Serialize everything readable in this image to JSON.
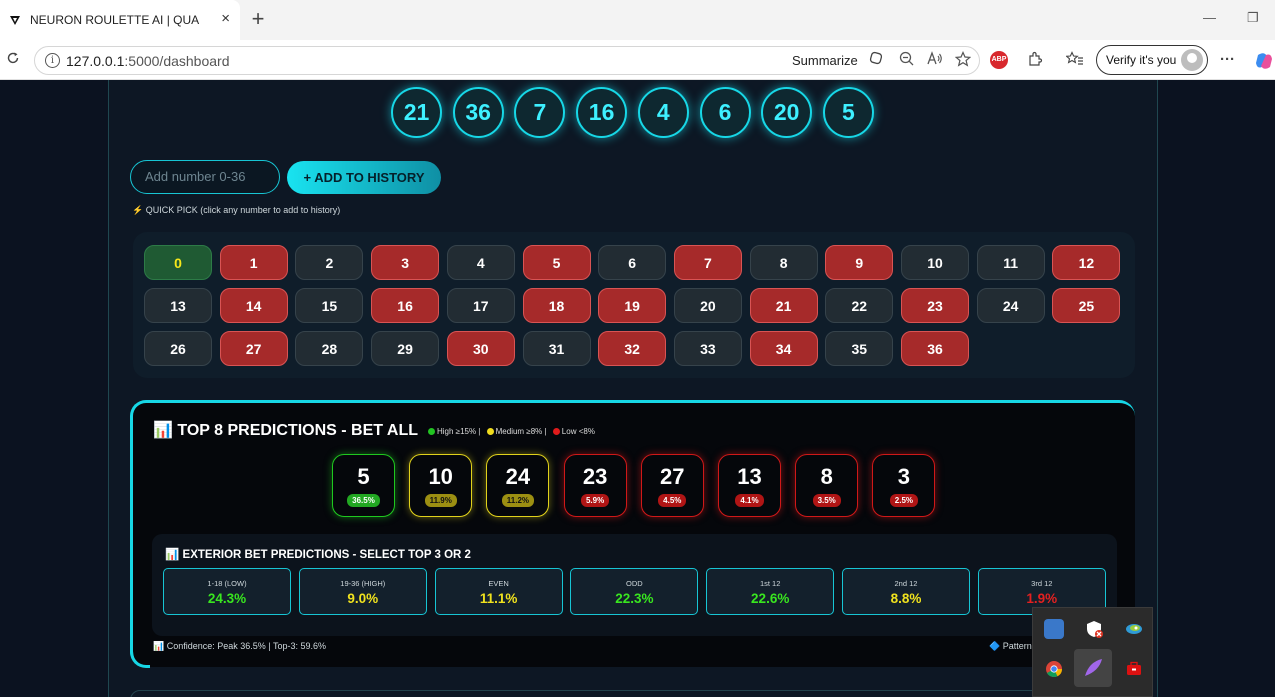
{
  "browser": {
    "tab_title": "NEURON ROULETTE AI | QUANTUM",
    "tab_close": "×",
    "new_tab": "+",
    "url_host": "127.0.0.1",
    "url_rest": ":5000/dashboard",
    "summarize_label": "Summarize",
    "abp_label": "ABP",
    "verify_label": "Verify it's you",
    "more_label": "···",
    "minimize": "—",
    "restore": "❐"
  },
  "history": {
    "numbers": [
      "21",
      "36",
      "7",
      "16",
      "4",
      "6",
      "20",
      "5"
    ]
  },
  "input": {
    "placeholder": "Add number 0-36",
    "add_button": "+ ADD TO HISTORY",
    "quick_pick_label": "QUICK PICK (click any number to add to history)"
  },
  "quick_pick": {
    "numbers": [
      {
        "n": "0",
        "c": "green"
      },
      {
        "n": "1",
        "c": "red"
      },
      {
        "n": "2",
        "c": "black"
      },
      {
        "n": "3",
        "c": "red"
      },
      {
        "n": "4",
        "c": "black"
      },
      {
        "n": "5",
        "c": "red"
      },
      {
        "n": "6",
        "c": "black"
      },
      {
        "n": "7",
        "c": "red"
      },
      {
        "n": "8",
        "c": "black"
      },
      {
        "n": "9",
        "c": "red"
      },
      {
        "n": "10",
        "c": "black"
      },
      {
        "n": "11",
        "c": "black"
      },
      {
        "n": "12",
        "c": "red"
      },
      {
        "n": "13",
        "c": "black"
      },
      {
        "n": "14",
        "c": "red"
      },
      {
        "n": "15",
        "c": "black"
      },
      {
        "n": "16",
        "c": "red"
      },
      {
        "n": "17",
        "c": "black"
      },
      {
        "n": "18",
        "c": "red"
      },
      {
        "n": "19",
        "c": "red"
      },
      {
        "n": "20",
        "c": "black"
      },
      {
        "n": "21",
        "c": "red"
      },
      {
        "n": "22",
        "c": "black"
      },
      {
        "n": "23",
        "c": "red"
      },
      {
        "n": "24",
        "c": "black"
      },
      {
        "n": "25",
        "c": "red"
      },
      {
        "n": "26",
        "c": "black"
      },
      {
        "n": "27",
        "c": "red"
      },
      {
        "n": "28",
        "c": "black"
      },
      {
        "n": "29",
        "c": "black"
      },
      {
        "n": "30",
        "c": "red"
      },
      {
        "n": "31",
        "c": "black"
      },
      {
        "n": "32",
        "c": "red"
      },
      {
        "n": "33",
        "c": "black"
      },
      {
        "n": "34",
        "c": "red"
      },
      {
        "n": "35",
        "c": "black"
      },
      {
        "n": "36",
        "c": "red"
      }
    ]
  },
  "predictions": {
    "title": "TOP 8 PREDICTIONS - BET ALL",
    "legend_high": "High ≥15% |",
    "legend_medium": "Medium ≥8% |",
    "legend_low": "Low <8%",
    "colors": {
      "high": "#22c322",
      "medium": "#f0dc1e",
      "low": "#e01b1b"
    },
    "items": [
      {
        "number": "5",
        "pct": "36.5%",
        "level": "high"
      },
      {
        "number": "10",
        "pct": "11.9%",
        "level": "medium"
      },
      {
        "number": "24",
        "pct": "11.2%",
        "level": "medium"
      },
      {
        "number": "23",
        "pct": "5.9%",
        "level": "low"
      },
      {
        "number": "27",
        "pct": "4.5%",
        "level": "low"
      },
      {
        "number": "13",
        "pct": "4.1%",
        "level": "low"
      },
      {
        "number": "8",
        "pct": "3.5%",
        "level": "low"
      },
      {
        "number": "3",
        "pct": "2.5%",
        "level": "low"
      }
    ]
  },
  "exterior": {
    "title": "EXTERIOR BET PREDICTIONS - SELECT TOP 3 OR 2",
    "items": [
      {
        "label": "1-18 (LOW)",
        "value": "24.3%",
        "color": "#39e61f"
      },
      {
        "label": "19-36 (HIGH)",
        "value": "9.0%",
        "color": "#f0e21e"
      },
      {
        "label": "EVEN",
        "value": "11.1%",
        "color": "#f0e21e"
      },
      {
        "label": "ODD",
        "value": "22.3%",
        "color": "#39e61f"
      },
      {
        "label": "1st 12",
        "value": "22.6%",
        "color": "#39e61f"
      },
      {
        "label": "2nd 12",
        "value": "8.8%",
        "color": "#f0e21e"
      },
      {
        "label": "3rd 12",
        "value": "1.9%",
        "color": "#e42020"
      }
    ]
  },
  "footer": {
    "confidence": "Confidence: Peak 36.5% | Top-3: 59.6%",
    "pattern": "Pattern"
  }
}
